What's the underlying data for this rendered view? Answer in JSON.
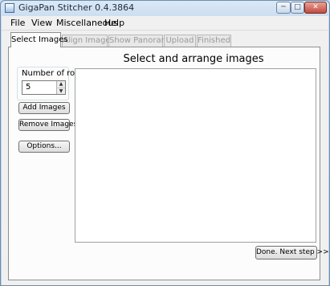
{
  "window": {
    "title": "GigaPan Stitcher 0.4.3864"
  },
  "menu": [
    "File",
    "View",
    "Miscellaneous",
    "Help"
  ],
  "tabs": [
    {
      "label": "Select Images",
      "active": true
    },
    {
      "label": "Align Images",
      "active": false
    },
    {
      "label": "Show Panorama",
      "active": false
    },
    {
      "label": "Upload",
      "active": false
    },
    {
      "label": "Finished",
      "active": false
    }
  ],
  "panel": {
    "heading": "Select and arrange images",
    "rows_label": "Number of rows",
    "rows_value": "5",
    "add_button": "Add Images",
    "remove_button": "Remove Images",
    "options_button": "Options...",
    "next_button": "Done.  Next step >>"
  }
}
